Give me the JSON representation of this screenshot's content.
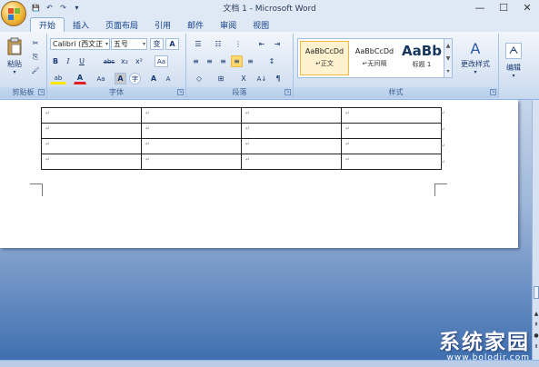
{
  "window": {
    "title": "文档 1 - Microsoft Word",
    "minimize": "—",
    "maximize": "☐",
    "close": "✕"
  },
  "qat": {
    "save": "💾",
    "undo": "↶",
    "redo": "↷",
    "customize": "▾"
  },
  "tabs": [
    "开始",
    "插入",
    "页面布局",
    "引用",
    "邮件",
    "审阅",
    "视图"
  ],
  "active_tab": "开始",
  "ribbon": {
    "clipboard": {
      "label": "剪贴板",
      "paste": "粘贴",
      "cut": "✂",
      "copy": "⎘",
      "format_painter": "🖌"
    },
    "font": {
      "label": "字体",
      "font_name": "Calibri (西文正",
      "font_size": "五号",
      "grow": "A",
      "shrink": "A",
      "bold": "B",
      "italic": "I",
      "underline": "U",
      "strike": "abc",
      "subscript": "x₂",
      "superscript": "x²",
      "clear": "Aa",
      "highlight": "ab",
      "font_color": "A",
      "change_case": "Aa",
      "char_shading": "A",
      "encircle": "字",
      "phonetic": "变",
      "border": "A",
      "pinyin": "A"
    },
    "paragraph": {
      "label": "段落",
      "bullets": "☰",
      "numbering": "☷",
      "multilevel": "⋮",
      "decrease_indent": "⇤",
      "increase_indent": "⇥",
      "align_left": "≡",
      "center": "≡",
      "align_right": "≡",
      "justify": "≡",
      "distributed": "≡",
      "line_spacing": "↕",
      "shading": "◇",
      "borders": "⊞",
      "chinese_layout": "X",
      "sort": "A↓",
      "show_marks": "¶"
    },
    "styles": {
      "label": "样式",
      "items": [
        {
          "sample": "AaBbCcDd",
          "name": "↵正文"
        },
        {
          "sample": "AaBbCcDd",
          "name": "↵无间隔"
        },
        {
          "sample": "AaBb",
          "name": "标题 1"
        }
      ],
      "change_styles": "更改样式"
    },
    "editing": {
      "label": "编辑",
      "icon": "ᗅ"
    }
  },
  "document": {
    "para_mark": "↵",
    "table_rows": 4,
    "table_cols": 4
  },
  "watermark": {
    "text": "系统家园",
    "url": "www.bolodir.com"
  }
}
